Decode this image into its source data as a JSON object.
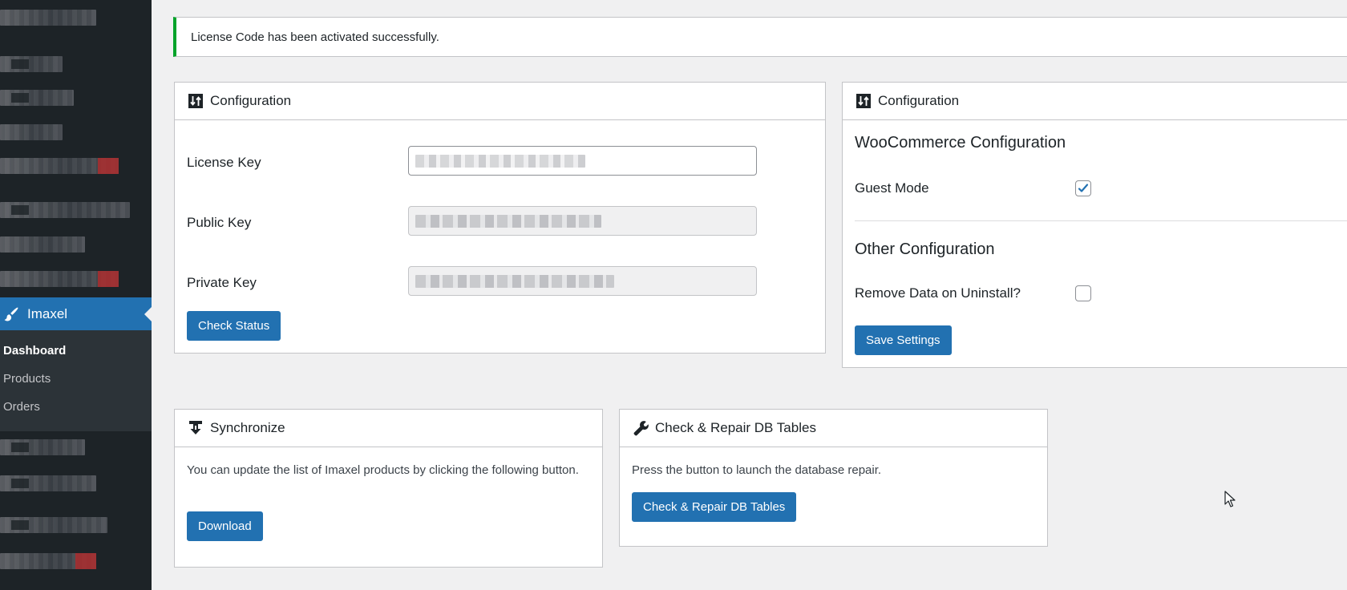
{
  "sidebar": {
    "active_menu": "Imaxel",
    "submenu": [
      "Dashboard",
      "Products",
      "Orders"
    ]
  },
  "notice": {
    "message": "License Code has been activated successfully."
  },
  "config_panel": {
    "title": "Configuration",
    "license_key_label": "License Key",
    "public_key_label": "Public Key",
    "private_key_label": "Private Key",
    "check_status_label": "Check Status"
  },
  "woo_panel": {
    "title": "Configuration",
    "woocommerce_heading": "WooCommerce Configuration",
    "guest_mode_label": "Guest Mode",
    "guest_mode_checked": true,
    "other_heading": "Other Configuration",
    "remove_data_label": "Remove Data on Uninstall?",
    "remove_data_checked": false,
    "save_label": "Save Settings"
  },
  "sync_panel": {
    "title": "Synchronize",
    "description": "You can update the list of Imaxel products by clicking the following button.",
    "download_label": "Download"
  },
  "repair_panel": {
    "title": "Check & Repair DB Tables",
    "description": "Press the button to launch the database repair.",
    "button_label": "Check & Repair DB Tables"
  },
  "colors": {
    "admin_bar_bg": "#1d2327",
    "accent": "#2271b1",
    "success": "#00a32a",
    "page_bg": "#f0f0f1"
  },
  "icons": {
    "menu": "brush-icon",
    "configuration": "sort-arrows-icon",
    "synchronize": "download-arrow-icon",
    "repair": "wrench-icon",
    "checkbox_checked": "checkmark-icon"
  }
}
